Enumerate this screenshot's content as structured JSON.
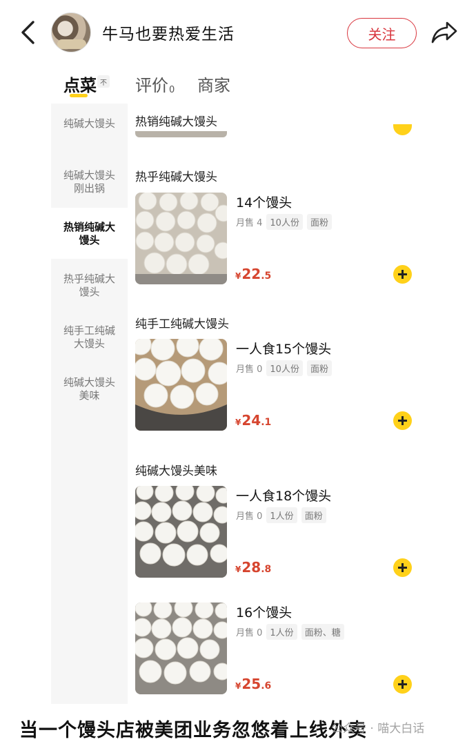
{
  "header": {
    "shop_name": "牛马也要热爱生活",
    "follow_label": "关注",
    "back_icon": "chevron-left-icon",
    "share_icon": "share-icon"
  },
  "tabs": {
    "order": "点菜",
    "order_badge": "不",
    "review": "评价",
    "review_count": "0",
    "merchant": "商家"
  },
  "sidebar": {
    "categories": [
      "纯碱大馒头",
      "纯碱大馒头刚出锅",
      "热销纯碱大馒头",
      "热乎纯碱大馒头",
      "纯手工纯碱大馒头",
      "纯碱大馒头美味"
    ],
    "active_index": 2
  },
  "menu": {
    "top_section": "热销纯碱大馒头",
    "sections": [
      {
        "title": "热乎纯碱大馒头",
        "name": "14个馒头",
        "sold": "月售 4",
        "tags": [
          "10人份",
          "面粉"
        ],
        "price_yen": "¥",
        "price_int": "22",
        "price_dec": ".5"
      },
      {
        "title": "纯手工纯碱大馒头",
        "name": "一人食15个馒头",
        "sold": "月售 0",
        "tags": [
          "10人份",
          "面粉"
        ],
        "price_yen": "¥",
        "price_int": "24",
        "price_dec": ".1"
      },
      {
        "title": "纯碱大馒头美味",
        "name": "一人食18个馒头",
        "sold": "月售 0",
        "tags": [
          "1人份",
          "面粉"
        ],
        "price_yen": "¥",
        "price_int": "28",
        "price_dec": ".8"
      },
      {
        "title": "",
        "name": "16个馒头",
        "sold": "月售 0",
        "tags": [
          "1人份",
          "面粉、糖"
        ],
        "price_yen": "¥",
        "price_int": "25",
        "price_dec": ".6"
      }
    ]
  },
  "caption": "当一个馒头店被美团业务忽悠着上线外卖",
  "watermark": "公众号 · 喵大白话",
  "colors": {
    "accent_yellow": "#ffd11a",
    "price_red": "#d6452f",
    "follow_red": "#d8343c"
  }
}
